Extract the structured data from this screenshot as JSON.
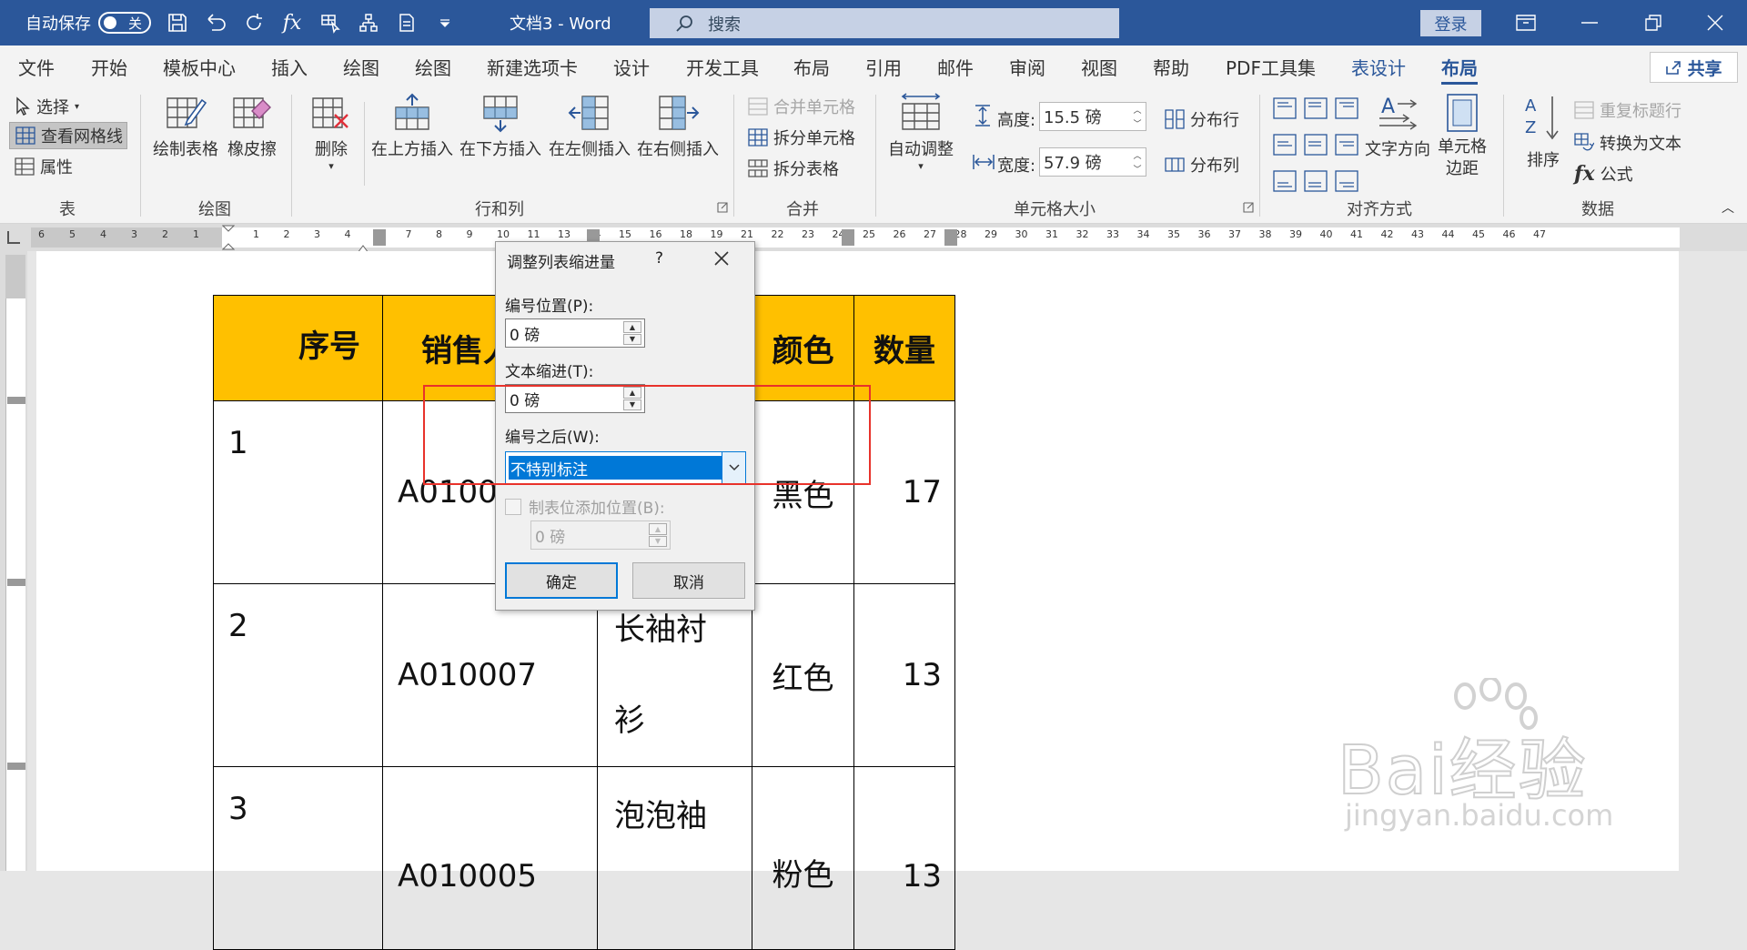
{
  "titlebar": {
    "autosave_label": "自动保存",
    "autosave_state": "关",
    "doc_title": "文档3 - Word",
    "search_placeholder": "搜索",
    "login": "登录"
  },
  "menu": {
    "tabs": [
      "文件",
      "开始",
      "模板中心",
      "插入",
      "绘图",
      "绘图",
      "新建选项卡",
      "设计",
      "开发工具",
      "布局",
      "引用",
      "邮件",
      "审阅",
      "视图",
      "帮助",
      "PDF工具集",
      "表设计",
      "布局"
    ],
    "share": "共享"
  },
  "ribbon": {
    "table_group": {
      "select": "选择",
      "gridlines": "查看网格线",
      "properties": "属性",
      "label": "表"
    },
    "draw_group": {
      "draw_table": "绘制表格",
      "eraser": "橡皮擦",
      "label": "绘图"
    },
    "rowcol_group": {
      "delete": "删除",
      "insert_above": "在上方插入",
      "insert_below": "在下方插入",
      "insert_left": "在左侧插入",
      "insert_right": "在右侧插入",
      "label": "行和列"
    },
    "merge_group": {
      "merge_cells": "合并单元格",
      "split_cells": "拆分单元格",
      "split_table": "拆分表格",
      "label": "合并"
    },
    "cellsize_group": {
      "autofit": "自动调整",
      "height_label": "高度:",
      "height_value": "15.5 磅",
      "width_label": "宽度:",
      "width_value": "57.9 磅",
      "distribute_rows": "分布行",
      "distribute_cols": "分布列",
      "label": "单元格大小"
    },
    "align_group": {
      "text_direction": "文字方向",
      "cell_margins_1": "单元格",
      "cell_margins_2": "边距",
      "label": "对齐方式"
    },
    "data_group": {
      "sort": "排序",
      "repeat_header": "重复标题行",
      "convert_text": "转换为文本",
      "formula": "公式",
      "label": "数据"
    }
  },
  "ruler": {
    "left_ticks": [
      "6",
      "5",
      "4",
      "3",
      "2",
      "1"
    ],
    "mid_ticks": [
      "1",
      "2",
      "3",
      "4",
      "6",
      "7",
      "8",
      "9",
      "10",
      "11",
      "13",
      "14",
      "15",
      "16",
      "18",
      "19",
      "21",
      "22",
      "23",
      "24",
      "25",
      "26",
      "27",
      "28",
      "29",
      "30",
      "31",
      "32",
      "33",
      "34",
      "35",
      "36",
      "37",
      "38",
      "39",
      "40",
      "41",
      "42",
      "43",
      "44",
      "45",
      "46",
      "47"
    ]
  },
  "table": {
    "headers": [
      "序号",
      "销售人",
      "",
      "颜色",
      "数量"
    ],
    "rows": [
      {
        "no": "1",
        "code": "A0100",
        "name": "",
        "color": "黑色",
        "qty": "17"
      },
      {
        "no": "2",
        "code": "A010007",
        "name": "长袖衬衫",
        "name1": "长袖衬",
        "name2": "衫",
        "color": "红色",
        "qty": "13"
      },
      {
        "no": "3",
        "code": "A010005",
        "name": "泡泡袖",
        "color": "粉色",
        "qty": "13"
      }
    ]
  },
  "dialog": {
    "title": "调整列表缩进量",
    "help": "?",
    "number_position_label": "编号位置(P):",
    "number_position_value": "0 磅",
    "text_indent_label": "文本缩进(T):",
    "text_indent_value": "0 磅",
    "follow_label": "编号之后(W):",
    "follow_value": "不特别标注",
    "tab_check_label": "制表位添加位置(B):",
    "tab_value": "0 磅",
    "ok": "确定",
    "cancel": "取消"
  },
  "watermark": {
    "brand": "Bai经验",
    "url": "jingyan.baidu.com"
  },
  "colors": {
    "titlebar": "#2b579a",
    "header_fill": "#ffc000",
    "highlight": "#e8322b",
    "select": "#0078d7"
  }
}
